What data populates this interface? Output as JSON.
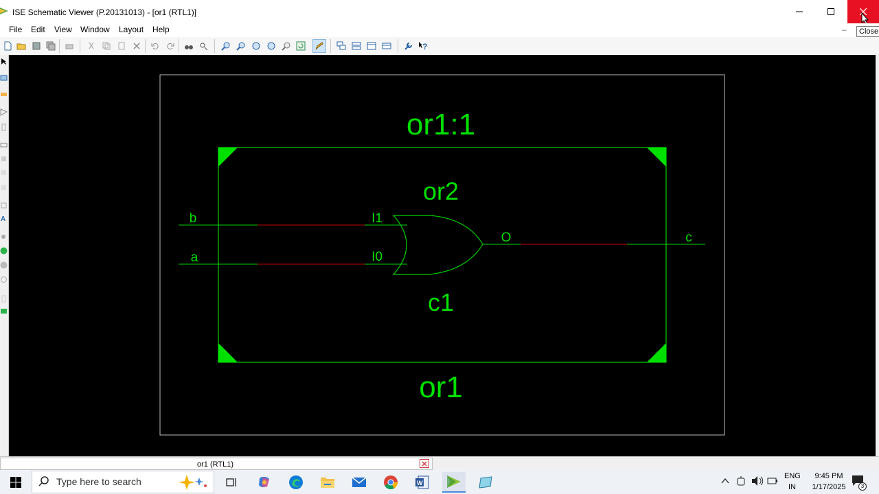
{
  "window": {
    "title": "ISE Schematic Viewer (P.20131013) - [or1 (RTL1)]",
    "close_tooltip": "Close"
  },
  "menu": [
    "File",
    "Edit",
    "View",
    "Window",
    "Layout",
    "Help"
  ],
  "schematic": {
    "outer_instance": "or1:1",
    "module_name": "or1",
    "gate_type": "or2",
    "gate_instance": "c1",
    "pin_in1": "I1",
    "pin_in0": "I0",
    "pin_out": "O",
    "port_b": "b",
    "port_a": "a",
    "port_c": "c"
  },
  "status": {
    "tab_label": "or1 (RTL1)"
  },
  "taskbar": {
    "search_placeholder": "Type here to search",
    "lang_top": "ENG",
    "lang_bottom": "IN",
    "time": "9:45 PM",
    "date": "1/17/2025",
    "notification_count": "3"
  },
  "colors": {
    "wire": "#00e000",
    "net_red": "#c00000",
    "close_red": "#e81123"
  },
  "icons": [
    "app-icon",
    "minimize-icon",
    "maximize-icon",
    "close-icon",
    "search-icon",
    "windows-start-icon"
  ]
}
